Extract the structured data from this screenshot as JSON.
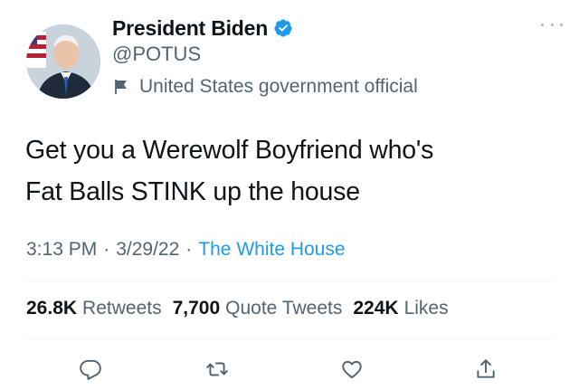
{
  "tweet": {
    "author": {
      "display_name": "President Biden",
      "handle": "@POTUS",
      "affiliation_label": "United States government official",
      "verified": true,
      "verified_color": "#1d9bf0"
    },
    "text": "Get you a Werewolf Boyfriend who's\nFat Balls STINK up the house",
    "meta": {
      "time": "3:13 PM",
      "separator": "·",
      "date": "3/29/22",
      "source": "The White House"
    },
    "stats": {
      "retweets_count": "26.8K",
      "retweets_label": "Retweets",
      "quote_count": "7,700",
      "quote_label": "Quote Tweets",
      "likes_count": "224K",
      "likes_label": "Likes"
    },
    "actions": [
      "reply-icon",
      "retweet-icon",
      "like-icon",
      "share-icon"
    ],
    "colors": {
      "text": "#0f1419",
      "secondary": "#536471",
      "link": "#1d9bf0",
      "divider": "#eff3f4"
    }
  }
}
